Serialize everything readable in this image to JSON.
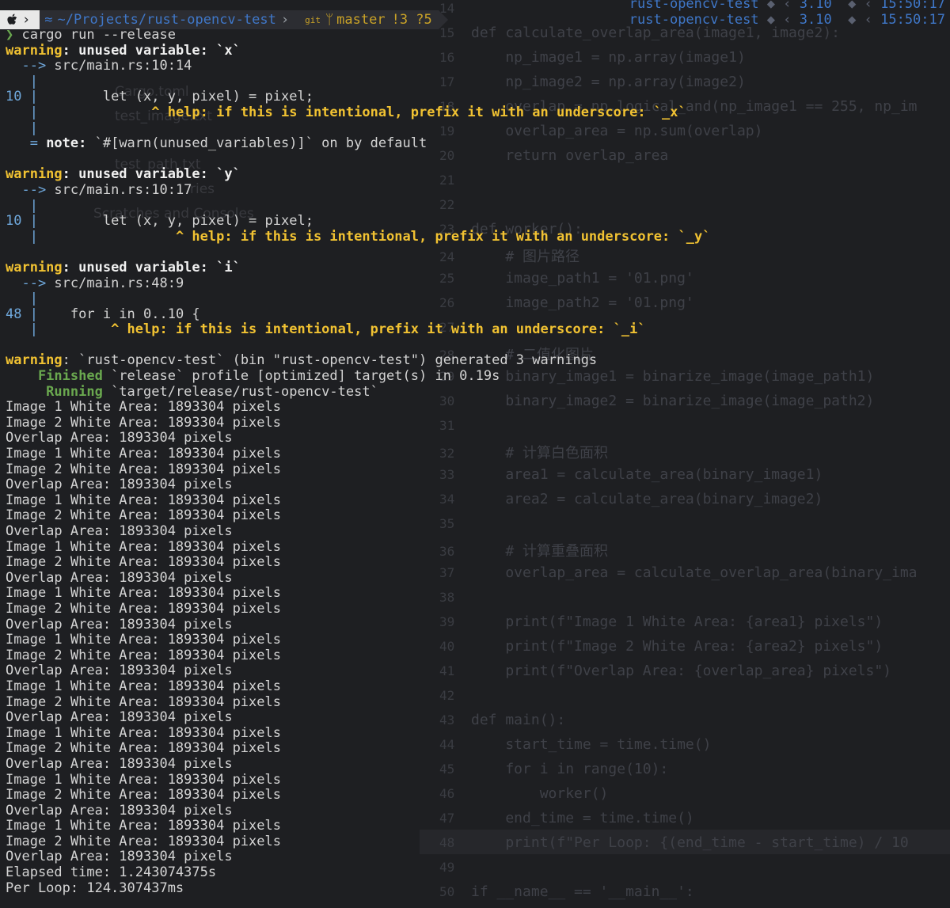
{
  "window": {
    "prompt": {
      "path": "~/Projects/rust-opencv-test",
      "branch": "master",
      "git_status": "!3 ?5"
    },
    "right_prompt": [
      {
        "name": "rust-opencv-test",
        "version": "3.10",
        "time": "15:50:17"
      },
      {
        "name": "rust-opencv-test",
        "version": "3.10",
        "time": "15:50:17"
      }
    ]
  },
  "terminal": {
    "command_symbol": "❯",
    "command": "cargo run --release",
    "warnings": [
      {
        "label": "warning",
        "message": "unused variable: `x`",
        "arrow": "  -->",
        "location": "src/main.rs:10:14",
        "line_no": "10",
        "code": "    let (x, y, pixel) = pixel;",
        "caret_indent": "              ",
        "help": "help: if this is intentional, prefix it with an underscore: `_x`",
        "note_label": "note",
        "note": "`#[warn(unused_variables)]` on by default"
      },
      {
        "label": "warning",
        "message": "unused variable: `y`",
        "arrow": "  -->",
        "location": "src/main.rs:10:17",
        "line_no": "10",
        "code": "    let (x, y, pixel) = pixel;",
        "caret_indent": "                 ",
        "help": "help: if this is intentional, prefix it with an underscore: `_y`"
      },
      {
        "label": "warning",
        "message": "unused variable: `i`",
        "arrow": "  -->",
        "location": "src/main.rs:48:9",
        "line_no": "48",
        "code": "for i in 0..10 {",
        "caret_indent": "         ",
        "help": "help: if this is intentional, prefix it with an underscore: `_i`"
      }
    ],
    "summary_label": "warning",
    "summary": "`rust-opencv-test` (bin \"rust-opencv-test\") generated 3 warnings",
    "finished_label": "Finished",
    "finished": "`release` profile [optimized] target(s) in 0.19s",
    "running_label": "Running",
    "running": "`target/release/rust-opencv-test`",
    "output_lines": [
      "Image 1 White Area: 1893304 pixels",
      "Image 2 White Area: 1893304 pixels",
      "Overlap Area: 1893304 pixels",
      "Image 1 White Area: 1893304 pixels",
      "Image 2 White Area: 1893304 pixels",
      "Overlap Area: 1893304 pixels",
      "Image 1 White Area: 1893304 pixels",
      "Image 2 White Area: 1893304 pixels",
      "Overlap Area: 1893304 pixels",
      "Image 1 White Area: 1893304 pixels",
      "Image 2 White Area: 1893304 pixels",
      "Overlap Area: 1893304 pixels",
      "Image 1 White Area: 1893304 pixels",
      "Image 2 White Area: 1893304 pixels",
      "Overlap Area: 1893304 pixels",
      "Image 1 White Area: 1893304 pixels",
      "Image 2 White Area: 1893304 pixels",
      "Overlap Area: 1893304 pixels",
      "Image 1 White Area: 1893304 pixels",
      "Image 2 White Area: 1893304 pixels",
      "Overlap Area: 1893304 pixels",
      "Image 1 White Area: 1893304 pixels",
      "Image 2 White Area: 1893304 pixels",
      "Overlap Area: 1893304 pixels",
      "Image 1 White Area: 1893304 pixels",
      "Image 2 White Area: 1893304 pixels",
      "Overlap Area: 1893304 pixels",
      "Image 1 White Area: 1893304 pixels",
      "Image 2 White Area: 1893304 pixels",
      "Overlap Area: 1893304 pixels",
      "Elapsed time: 1.243074375s",
      "Per Loop: 124.307437ms"
    ]
  },
  "background_editor": {
    "sidebar_items": [
      "Cargo.toml",
      "test_image.txt",
      "test_path.txt",
      "ries",
      "Scratches and Consoles"
    ],
    "lines": [
      {
        "n": "14",
        "code": ""
      },
      {
        "n": "15",
        "code": "def calculate_overlap_area(image1, image2):"
      },
      {
        "n": "16",
        "code": "    np_image1 = np.array(image1)"
      },
      {
        "n": "17",
        "code": "    np_image2 = np.array(image2)"
      },
      {
        "n": "18",
        "code": "    overlap = np.logical_and(np_image1 == 255, np_im"
      },
      {
        "n": "19",
        "code": "    overlap_area = np.sum(overlap)"
      },
      {
        "n": "20",
        "code": "    return overlap_area"
      },
      {
        "n": "21",
        "code": ""
      },
      {
        "n": "22",
        "code": ""
      },
      {
        "n": "23",
        "code": "def worker():"
      },
      {
        "n": "24",
        "code": "    # 图片路径"
      },
      {
        "n": "25",
        "code": "    image_path1 = '01.png'"
      },
      {
        "n": "26",
        "code": "    image_path2 = '01.png'"
      },
      {
        "n": "27",
        "code": ""
      },
      {
        "n": "28",
        "code": "    # 二值化图片"
      },
      {
        "n": "29",
        "code": "    binary_image1 = binarize_image(image_path1)"
      },
      {
        "n": "30",
        "code": "    binary_image2 = binarize_image(image_path2)"
      },
      {
        "n": "31",
        "code": ""
      },
      {
        "n": "32",
        "code": "    # 计算白色面积"
      },
      {
        "n": "33",
        "code": "    area1 = calculate_area(binary_image1)"
      },
      {
        "n": "34",
        "code": "    area2 = calculate_area(binary_image2)"
      },
      {
        "n": "35",
        "code": ""
      },
      {
        "n": "36",
        "code": "    # 计算重叠面积"
      },
      {
        "n": "37",
        "code": "    overlap_area = calculate_overlap_area(binary_ima"
      },
      {
        "n": "38",
        "code": ""
      },
      {
        "n": "39",
        "code": "    print(f\"Image 1 White Area: {area1} pixels\")"
      },
      {
        "n": "40",
        "code": "    print(f\"Image 2 White Area: {area2} pixels\")"
      },
      {
        "n": "41",
        "code": "    print(f\"Overlap Area: {overlap_area} pixels\")"
      },
      {
        "n": "42",
        "code": ""
      },
      {
        "n": "43",
        "code": "def main():"
      },
      {
        "n": "44",
        "code": "    start_time = time.time()"
      },
      {
        "n": "45",
        "code": "    for i in range(10):"
      },
      {
        "n": "46",
        "code": "        worker()"
      },
      {
        "n": "47",
        "code": "    end_time = time.time()"
      },
      {
        "n": "48",
        "code": "    print(f\"Per Loop: {(end_time - start_time) / 10"
      },
      {
        "n": "49",
        "code": ""
      },
      {
        "n": "50",
        "code": "if __name__ == '__main__':"
      }
    ]
  }
}
